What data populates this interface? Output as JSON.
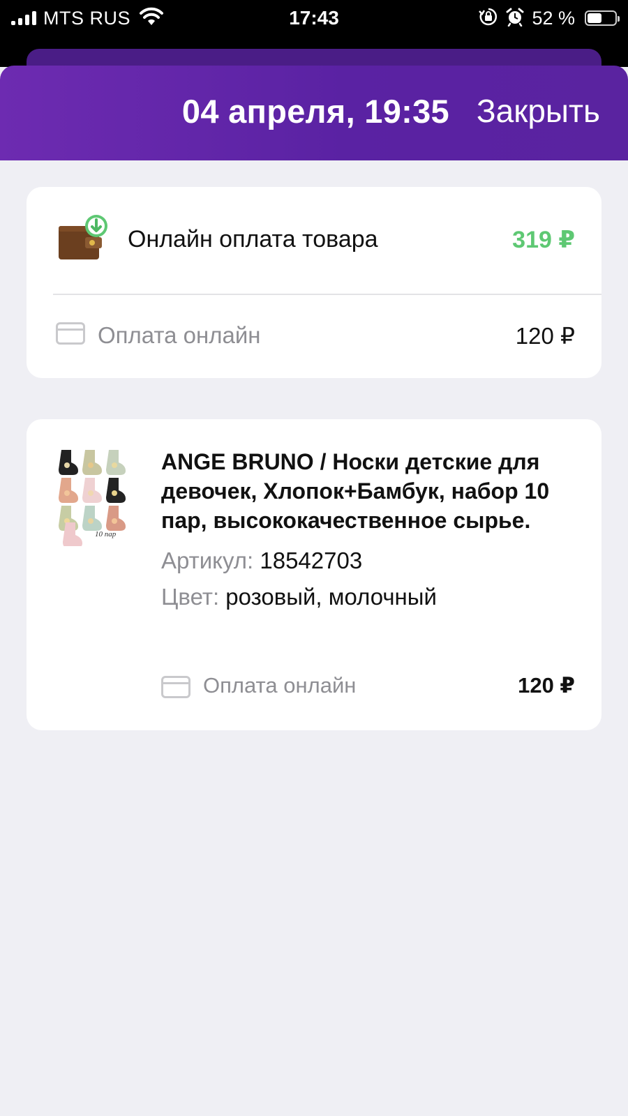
{
  "status_bar": {
    "carrier": "MTS RUS",
    "time": "17:43",
    "battery_percent": "52 %",
    "battery_level": 0.52,
    "icons": [
      "signal-icon",
      "wifi-icon",
      "orientation-lock-icon",
      "alarm-icon",
      "battery-icon"
    ]
  },
  "header": {
    "date": "04 апреля, 19:35",
    "close_label": "Закрыть",
    "accent_color": "#5a22a3"
  },
  "summary": {
    "icon": "wallet-download-icon",
    "title": "Онлайн оплата товара",
    "amount": "319 ₽",
    "amount_color": "#5ec873",
    "payment": {
      "icon": "credit-card-icon",
      "label": "Оплата онлайн",
      "amount": "120 ₽"
    }
  },
  "product": {
    "image_caption": "10 пар",
    "title": "ANGE BRUNO / Носки детские для девочек, Хлопок+Бамбук, набор 10 пар, высококачественное сырье.",
    "article_label": "Артикул:",
    "article_value": "18542703",
    "color_label": "Цвет:",
    "color_value": "розовый, молочный",
    "payment": {
      "icon": "credit-card-icon",
      "label": "Оплата онлайн",
      "amount": "120 ₽"
    }
  }
}
